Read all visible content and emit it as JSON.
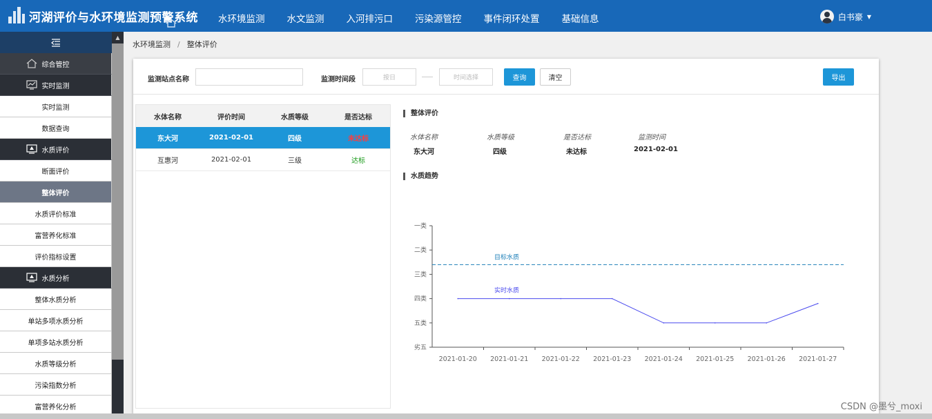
{
  "header": {
    "app_title": "河湖评价与水环境监测预警系统",
    "nav": [
      "水环境监测",
      "水文监测",
      "入河排污口",
      "污染源管控",
      "事件闭环处置",
      "基础信息"
    ],
    "user_name": "白书豪",
    "colors": {
      "bar": "#1868b8",
      "accent": "#1d96d8",
      "fail": "#e02020",
      "pass": "#1a9a1a"
    }
  },
  "sidebar": {
    "items": [
      {
        "label": "综合管控",
        "type": "group",
        "icon": "home-icon"
      },
      {
        "label": "实时监测",
        "type": "group",
        "icon": "chart-monitor-icon"
      },
      {
        "label": "实时监测",
        "type": "leaf"
      },
      {
        "label": "数据查询",
        "type": "leaf"
      },
      {
        "label": "水质评价",
        "type": "group",
        "icon": "monitor-icon"
      },
      {
        "label": "断面评价",
        "type": "leaf"
      },
      {
        "label": "整体评价",
        "type": "leaf",
        "active": true
      },
      {
        "label": "水质评价标准",
        "type": "leaf"
      },
      {
        "label": "富营养化标准",
        "type": "leaf"
      },
      {
        "label": "评价指标设置",
        "type": "leaf"
      },
      {
        "label": "水质分析",
        "type": "group",
        "icon": "monitor-icon"
      },
      {
        "label": "整体水质分析",
        "type": "leaf"
      },
      {
        "label": "单站多项水质分析",
        "type": "leaf"
      },
      {
        "label": "单项多站水质分析",
        "type": "leaf"
      },
      {
        "label": "水质等级分析",
        "type": "leaf"
      },
      {
        "label": "污染指数分析",
        "type": "leaf"
      },
      {
        "label": "富营养化分析",
        "type": "leaf"
      }
    ]
  },
  "breadcrumb": {
    "parent": "水环境监测",
    "sep": "/",
    "current": "整体评价"
  },
  "filter": {
    "station_label": "监测站点名称",
    "station_value": "",
    "period_label": "监测时间段",
    "start_placeholder": "按日",
    "end_placeholder": "时间选择",
    "query": "查询",
    "clear": "清空",
    "export": "导出"
  },
  "table": {
    "columns": [
      "水体名称",
      "评价时间",
      "水质等级",
      "是否达标"
    ],
    "rows": [
      {
        "name": "东大河",
        "date": "2021-02-01",
        "grade": "四级",
        "status": "未达标",
        "ok": false,
        "selected": true
      },
      {
        "name": "互惠河",
        "date": "2021-02-01",
        "grade": "三级",
        "status": "达标",
        "ok": true,
        "selected": false
      }
    ]
  },
  "overall": {
    "title": "整体评价",
    "fields": [
      "水体名称",
      "水质等级",
      "是否达标",
      "监测时间"
    ],
    "values": [
      "东大河",
      "四级",
      "未达标",
      "2021-02-01"
    ]
  },
  "trend": {
    "title": "水质趋势"
  },
  "chart_data": {
    "type": "line",
    "title": "",
    "xlabel": "",
    "ylabel": "",
    "categories": [
      "2021-01-20",
      "2021-01-21",
      "2021-01-22",
      "2021-01-23",
      "2021-01-24",
      "2021-01-25",
      "2021-01-26",
      "2021-01-27"
    ],
    "y_ticks": [
      "一类",
      "二类",
      "三类",
      "四类",
      "五类",
      "劣五"
    ],
    "ylim": [
      1,
      6
    ],
    "series": [
      {
        "name": "实时水质",
        "values": [
          4,
          4,
          4,
          4,
          5,
          5,
          5,
          4.2
        ],
        "color": "#4a4aee"
      }
    ],
    "reference": {
      "name": "目标水质",
      "value": 2.6,
      "color": "#1d7fb8",
      "style": "dashed"
    },
    "grid": false
  },
  "watermark": "CSDN @墨兮_moxi"
}
